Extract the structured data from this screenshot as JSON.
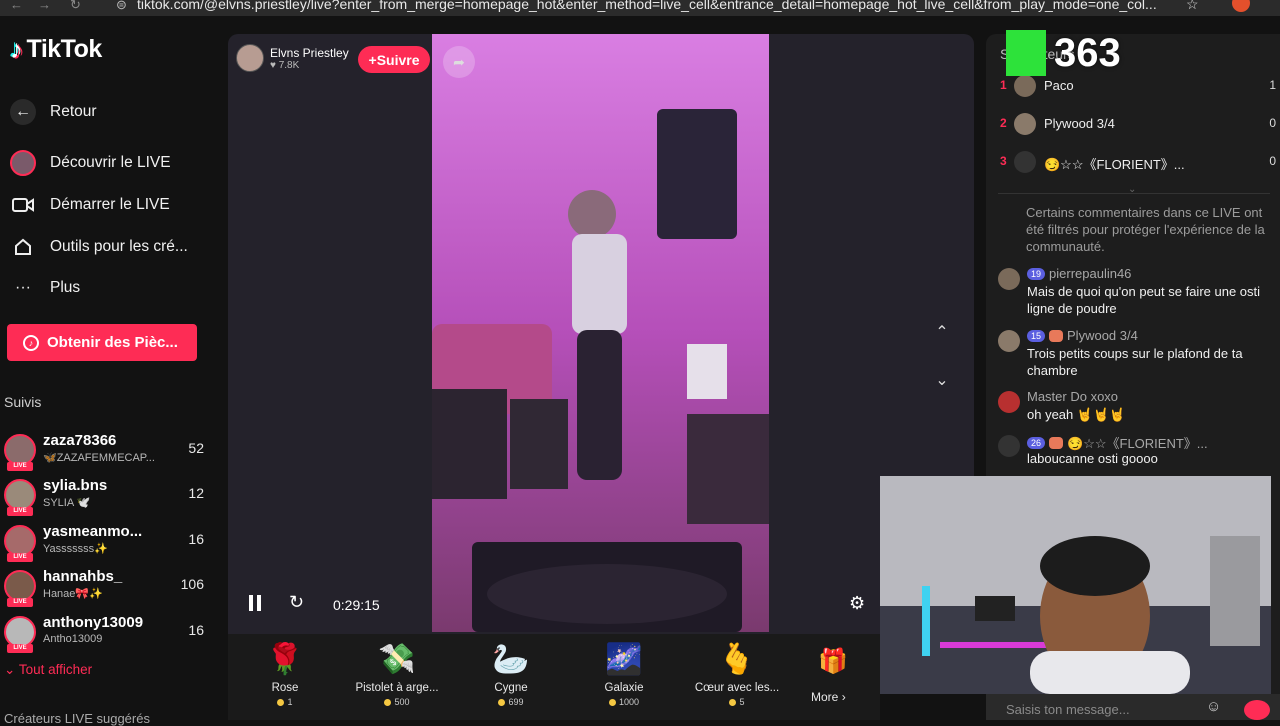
{
  "browser": {
    "url": "tiktok.com/@elvns.priestley/live?enter_from_merge=homepage_hot&enter_method=live_cell&entrance_detail=homepage_hot_live_cell&from_play_mode=one_col..."
  },
  "sidebar": {
    "logo": "TikTok",
    "nav": [
      {
        "label": "Retour",
        "icon": "arrow-left-icon"
      },
      {
        "label": "Découvrir le LIVE",
        "icon": "live-avatar-icon"
      },
      {
        "label": "Démarrer le LIVE",
        "icon": "camera-icon"
      },
      {
        "label": "Outils pour les cré...",
        "icon": "home-icon"
      },
      {
        "label": "Plus",
        "icon": "more-dots-icon"
      }
    ],
    "coins_button": "Obtenir des Pièc...",
    "following_title": "Suivis",
    "following": [
      {
        "name": "zaza78366",
        "sub": "🦋ZAZAFEMMECAP...",
        "count": "52"
      },
      {
        "name": "sylia.bns",
        "sub": "SYLIA 🕊️",
        "count": "12"
      },
      {
        "name": "yasmeanmo...",
        "sub": "Yasssssss✨",
        "count": "16"
      },
      {
        "name": "hannahbs_",
        "sub": "Hanae🎀✨",
        "count": "106"
      },
      {
        "name": "anthony13009",
        "sub": "Antho13009",
        "count": "16"
      }
    ],
    "show_all": "Tout afficher",
    "suggested_title": "Créateurs LIVE suggérés",
    "live_badge": "LIVE"
  },
  "stream": {
    "host_name": "Elvns Priestley",
    "host_likes": "7.8K",
    "follow_label": "Suivre",
    "time": "0:29:15"
  },
  "gifts": [
    {
      "name": "Rose",
      "price": "1",
      "icon": "rose-icon"
    },
    {
      "name": "Pistolet à arge...",
      "price": "500",
      "icon": "money-gun-icon"
    },
    {
      "name": "Cygne",
      "price": "699",
      "icon": "swan-icon"
    },
    {
      "name": "Galaxie",
      "price": "1000",
      "icon": "galaxy-icon"
    },
    {
      "name": "Cœur avec les...",
      "price": "5",
      "icon": "finger-heart-icon"
    }
  ],
  "gift_more": "More",
  "rankings": {
    "title": "Spectateurs",
    "items": [
      {
        "rank": "1",
        "name": "Paco",
        "score": "1"
      },
      {
        "rank": "2",
        "name": "Plywood 3/4",
        "score": "0"
      },
      {
        "rank": "3",
        "name": "😏☆☆《FLORIENT》...",
        "score": "0"
      }
    ]
  },
  "chat": {
    "system": "Certains commentaires dans ce LIVE ont été filtrés pour protéger l'expérience de la communauté.",
    "messages": [
      {
        "level": "19",
        "user": "pierrepaulin46",
        "text": "Mais de quoi qu'on peut se faire une osti ligne de poudre"
      },
      {
        "level": "15",
        "user": "Plywood 3/4",
        "text": "Trois petits coups sur le plafond de ta chambre"
      },
      {
        "level": "",
        "user": "Master Do xoxo",
        "text": "oh yeah 🤘🤘🤘"
      },
      {
        "level": "26",
        "user": "😏☆☆《FLORIENT》...",
        "text": "laboucanne osti goooo"
      }
    ],
    "input_placeholder": "Saisis ton message..."
  },
  "overlay": {
    "count": "363"
  }
}
